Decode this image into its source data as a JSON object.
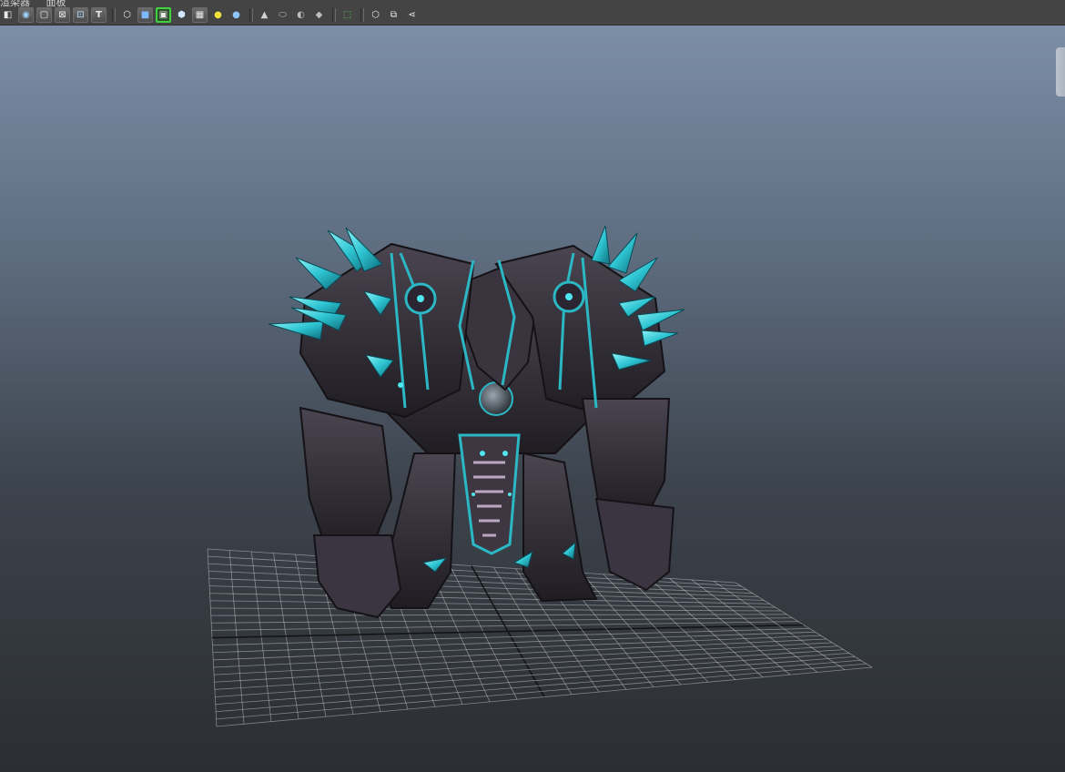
{
  "menu": {
    "items": [
      "渲染器",
      "面板"
    ]
  },
  "toolbar": {
    "buttons": [
      {
        "name": "isolate-icon",
        "glyph": "◧"
      },
      {
        "name": "camera-icon",
        "glyph": "◉"
      },
      {
        "name": "film-gate-icon",
        "glyph": "▢"
      },
      {
        "name": "gate-mask-icon",
        "glyph": "⊠"
      },
      {
        "name": "field-chart-icon",
        "glyph": "⊡"
      },
      {
        "name": "safe-title-icon",
        "glyph": "T"
      },
      {
        "name": "wireframe-icon",
        "glyph": "⬡"
      },
      {
        "name": "smooth-shade-icon",
        "glyph": "■"
      },
      {
        "name": "wireframe-on-shaded-icon",
        "glyph": "▣"
      },
      {
        "name": "xray-icon",
        "glyph": "⬢"
      },
      {
        "name": "textured-icon",
        "glyph": "▦"
      },
      {
        "name": "default-light-icon",
        "glyph": "●"
      },
      {
        "name": "all-lights-icon",
        "glyph": "●"
      },
      {
        "name": "shadows-icon",
        "glyph": "▲"
      },
      {
        "name": "ambient-occlusion-icon",
        "glyph": "⬭"
      },
      {
        "name": "antialias-icon",
        "glyph": "◐"
      },
      {
        "name": "depth-of-field-icon",
        "glyph": "◆"
      },
      {
        "name": "select-camera-icon",
        "glyph": "⬚"
      },
      {
        "name": "frame-all-icon",
        "glyph": "⬡"
      },
      {
        "name": "frame-selection-icon",
        "glyph": "⧉"
      },
      {
        "name": "share-icon",
        "glyph": "⋖"
      }
    ]
  },
  "colors": {
    "viewport_top": "#7c8ea6",
    "viewport_bottom": "#2b2e32",
    "accent_glow": "#35c9d6",
    "armor": "#2e2a30",
    "grid_line": "#c8c8c8"
  },
  "viewport": {
    "object": "armored-golem-character-model",
    "grid": "ground-grid"
  }
}
